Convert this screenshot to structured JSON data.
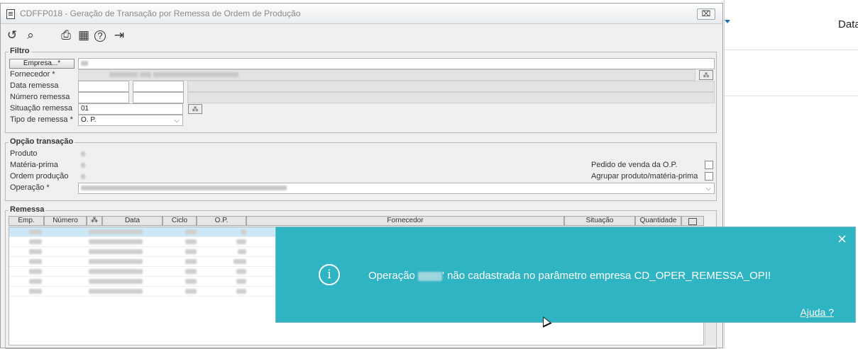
{
  "window": {
    "title": "CDFFP018 - Geração de Transação por Remessa de Ordem de Produção",
    "close_label": "⌧"
  },
  "toolbar": [
    {
      "name": "undo-icon",
      "glyph": "↺"
    },
    {
      "name": "search-icon",
      "glyph": "⌕"
    },
    {
      "name": "print-icon",
      "glyph": "⎙"
    },
    {
      "name": "calendar-icon",
      "glyph": "▦"
    },
    {
      "name": "help-icon",
      "glyph": "?"
    },
    {
      "name": "exit-icon",
      "glyph": "⇥"
    }
  ],
  "filtro": {
    "title": "Filtro",
    "empresa_button": "Empresa...*",
    "fornecedor_label": "Fornecedor *",
    "data_remessa_label": "Data remessa",
    "numero_remessa_label": "Número remessa",
    "situacao_label": "Situação remessa",
    "situacao_value": "01",
    "tipo_label": "Tipo de remessa *",
    "tipo_value": "O. P.",
    "lookup_label": "⁂"
  },
  "opcao": {
    "title": "Opção transação",
    "produto_label": "Produto",
    "materia_prima_label": "Matéria-prima",
    "ordem_producao_label": "Ordem produção",
    "operacao_label": "Operação *",
    "pedido_venda_label": "Pedido de venda da O.P.",
    "agrupar_label": "Agrupar produto/matéria-prima"
  },
  "remessa": {
    "title": "Remessa",
    "columns": [
      "Emp.",
      "Número",
      "⁂",
      "Data",
      "Ciclo",
      "O.P.",
      "Fornecedor",
      "Situação",
      "Quantidade"
    ]
  },
  "toast": {
    "message_prefix": "Operação",
    "message_suffix": "' não cadastrada no parâmetro empresa CD_OPER_REMESSA_OPI!",
    "close": "×",
    "info": "i",
    "help_link": "Ajuda ?"
  },
  "background": {
    "label": "Data"
  }
}
